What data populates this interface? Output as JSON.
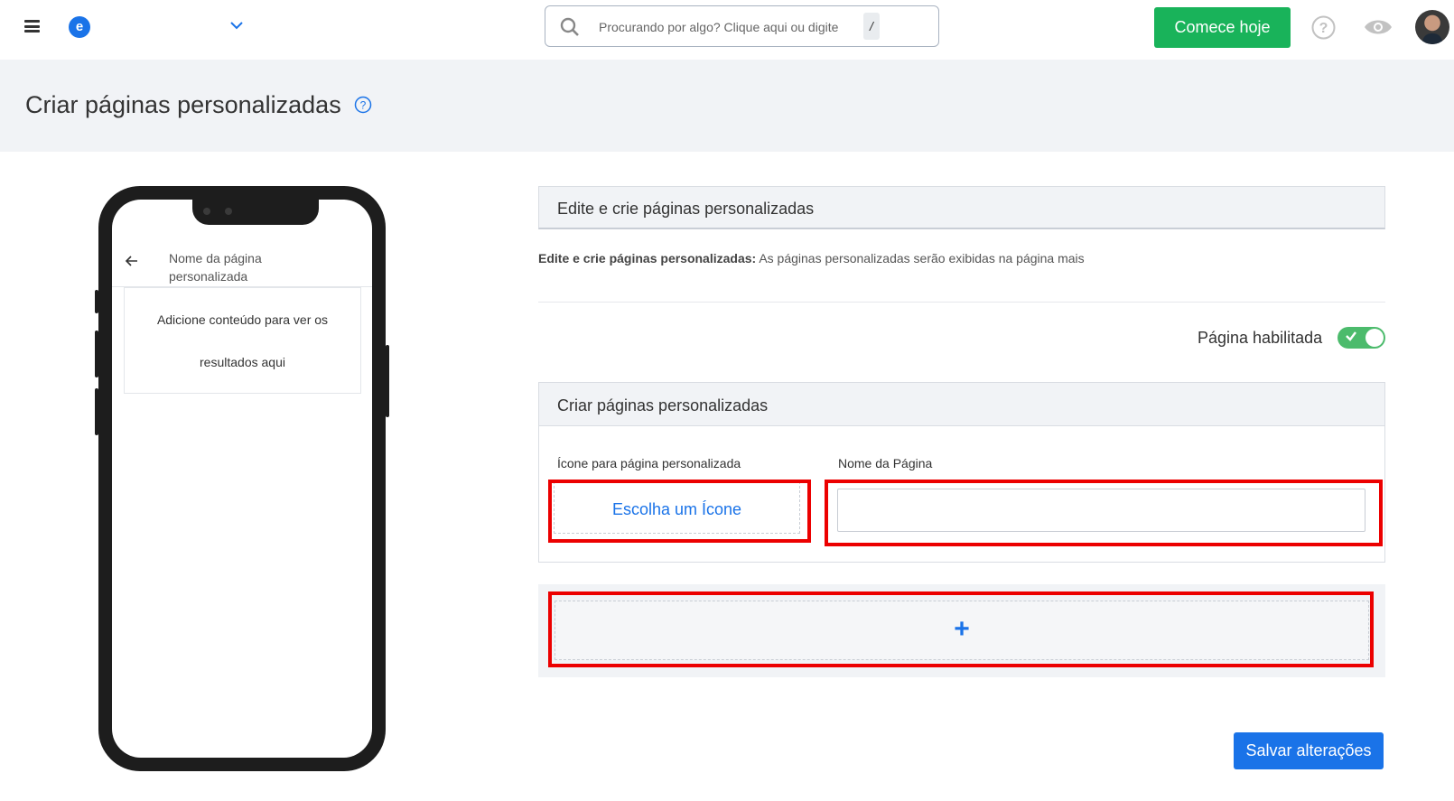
{
  "topbar": {
    "logo_letter": "e",
    "search_placeholder": "Procurando por algo? Clique aqui ou digite",
    "search_shortcut": "/",
    "start_button": "Comece hoje"
  },
  "page": {
    "title": "Criar páginas personalizadas"
  },
  "phone": {
    "page_name": "Nome da página personalizada",
    "content_line1": "Adicione conteúdo para ver os",
    "content_line2": "resultados aqui"
  },
  "edit_panel": {
    "title": "Edite e crie páginas personalizadas",
    "desc_bold": "Edite e crie páginas personalizadas:",
    "desc_text": " As páginas personalizadas serão exibidas na página mais"
  },
  "toggle": {
    "label": "Página habilitada",
    "enabled": true
  },
  "create_panel": {
    "title": "Criar páginas personalizadas",
    "icon_label": "Ícone para página personalizada",
    "name_label": "Nome da Página",
    "choose_icon": "Escolha um Ícone",
    "name_value": ""
  },
  "add_button": "+",
  "save_button": "Salvar alterações",
  "colors": {
    "primary": "#1a73e8",
    "success": "#19b35a",
    "toggle": "#4cbb6c",
    "highlight": "#ec0000"
  }
}
